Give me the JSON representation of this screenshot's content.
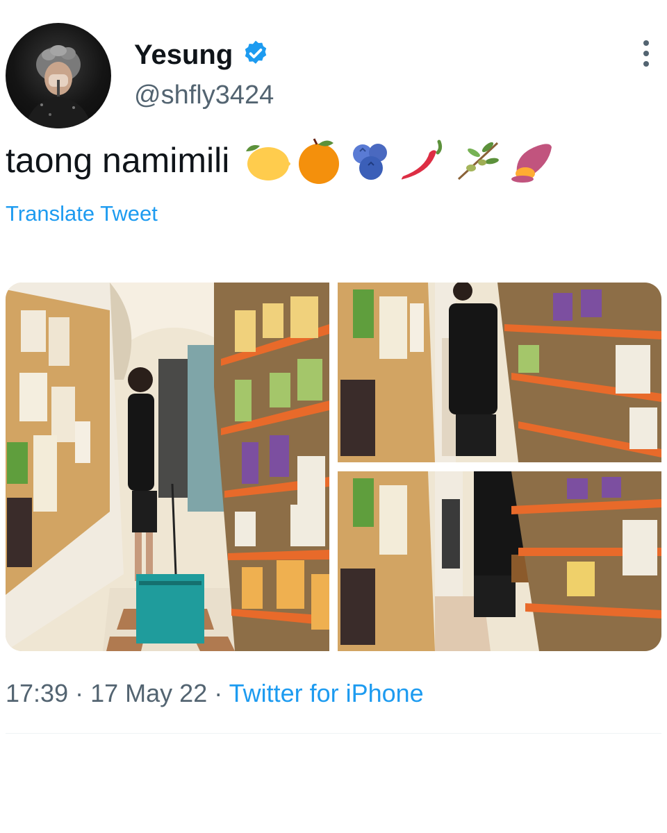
{
  "tweet": {
    "author_name": "Yesung",
    "author_handle": "@shfly3424",
    "verified": true,
    "text": "taong namimili",
    "emojis": [
      "lemon-emoji",
      "orange-emoji",
      "blueberries-emoji",
      "hot-pepper-emoji",
      "olive-branch-emoji",
      "sweet-potato-emoji"
    ],
    "translate_label": "Translate Tweet",
    "time": "17:39",
    "date": "17 May 22",
    "source": "Twitter for iPhone",
    "media_count": 3
  },
  "colors": {
    "link": "#1d9bf0",
    "secondary_text": "#536471",
    "primary_text": "#0f1419",
    "verified_badge": "#1d9bf0"
  }
}
